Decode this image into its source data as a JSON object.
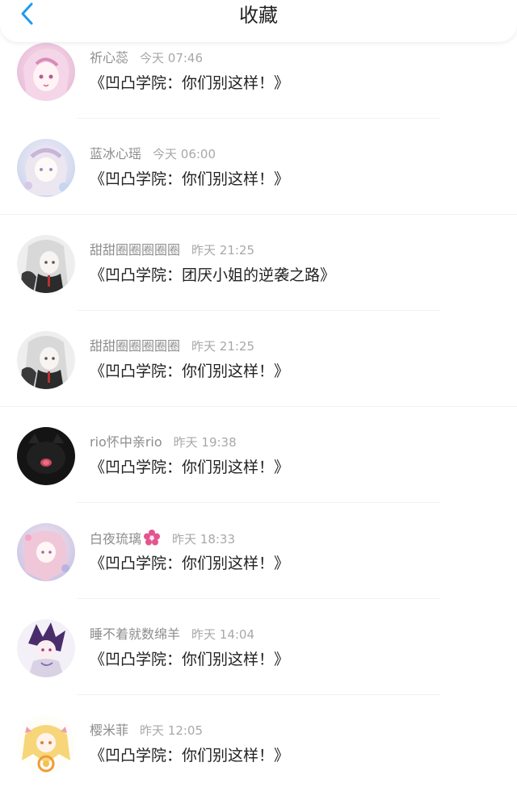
{
  "header": {
    "title": "收藏",
    "back_icon": "chevron-left-icon",
    "accent": "#1e9bf0"
  },
  "items": [
    {
      "user": "祈心蕊",
      "time": "今天 07:46",
      "text": "《凹凸学院：你们别这样！》",
      "avatar": "pink-anime-girl-avatar"
    },
    {
      "user": "蓝冰心瑶",
      "time": "今天 06:00",
      "text": "《凹凸学院：你们别这样！》",
      "avatar": "pale-anime-girl-avatar"
    },
    {
      "user": "甜甜圈圈圈圈圈",
      "time": "昨天 21:25",
      "text": "《凹凸学院：团厌小姐的逆袭之路》",
      "avatar": "grey-hair-girl-avatar"
    },
    {
      "user": "甜甜圈圈圈圈圈",
      "time": "昨天 21:25",
      "text": "《凹凸学院：你们别这样！》",
      "avatar": "grey-hair-girl-avatar"
    },
    {
      "user": "rio怀中亲rio",
      "time": "昨天 19:38",
      "text": "《凹凸学院：你们别这样！》",
      "avatar": "black-cat-avatar"
    },
    {
      "user": "白夜琉璃",
      "time": "昨天 18:33",
      "text": "《凹凸学院：你们别这样！》",
      "avatar": "pink-blossom-girl-avatar",
      "badge_icon": "flower-icon"
    },
    {
      "user": "睡不着就数绵羊",
      "time": "昨天 14:04",
      "text": "《凹凸学院：你们别这样！》",
      "avatar": "purple-hair-boy-avatar"
    },
    {
      "user": "樱米菲",
      "time": "昨天 12:05",
      "text": "《凹凸学院：你们别这样！》",
      "avatar": "blonde-chibi-girl-avatar"
    }
  ]
}
